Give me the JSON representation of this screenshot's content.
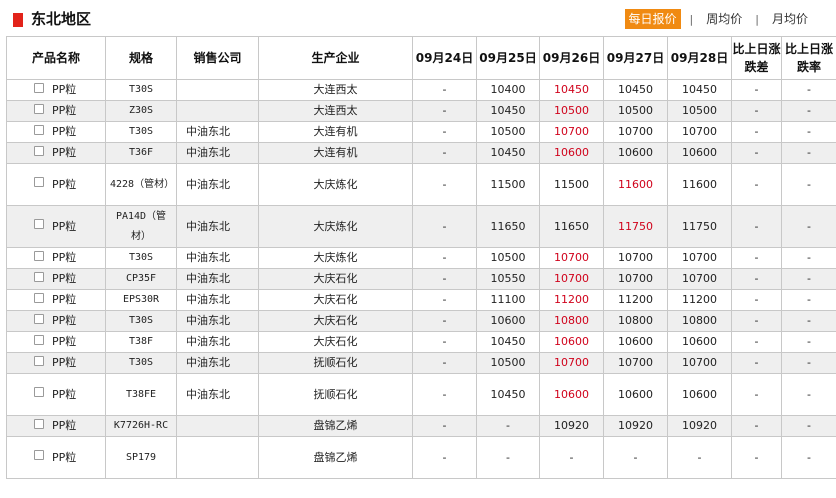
{
  "header": {
    "title": "东北地区",
    "tabs": [
      {
        "label": "每日报价",
        "active": true
      },
      {
        "label": "周均价",
        "active": false
      },
      {
        "label": "月均价",
        "active": false
      }
    ],
    "separator": "|"
  },
  "table": {
    "columns": [
      "产品名称",
      "规格",
      "销售公司",
      "生产企业",
      "09月24日",
      "09月25日",
      "09月26日",
      "09月27日",
      "09月28日",
      "比上日涨跌差",
      "比上日涨跌率"
    ],
    "rows": [
      {
        "product": "PP粒",
        "spec": "T30S",
        "company": "",
        "producer": "大连西太",
        "d24": "-",
        "d25": "10400",
        "d26": "10450",
        "d27": "10450",
        "d28": "10450",
        "diff": "-",
        "rate": "-",
        "red": "d26",
        "alt": false,
        "tall": false
      },
      {
        "product": "PP粒",
        "spec": "Z30S",
        "company": "",
        "producer": "大连西太",
        "d24": "-",
        "d25": "10450",
        "d26": "10500",
        "d27": "10500",
        "d28": "10500",
        "diff": "-",
        "rate": "-",
        "red": "d26",
        "alt": true,
        "tall": false
      },
      {
        "product": "PP粒",
        "spec": "T30S",
        "company": "中油东北",
        "producer": "大连有机",
        "d24": "-",
        "d25": "10500",
        "d26": "10700",
        "d27": "10700",
        "d28": "10700",
        "diff": "-",
        "rate": "-",
        "red": "d26",
        "alt": false,
        "tall": false
      },
      {
        "product": "PP粒",
        "spec": "T36F",
        "company": "中油东北",
        "producer": "大连有机",
        "d24": "-",
        "d25": "10450",
        "d26": "10600",
        "d27": "10600",
        "d28": "10600",
        "diff": "-",
        "rate": "-",
        "red": "d26",
        "alt": true,
        "tall": false
      },
      {
        "product": "PP粒",
        "spec": "4228（管材）",
        "company": "中油东北",
        "producer": "大庆炼化",
        "d24": "-",
        "d25": "11500",
        "d26": "11500",
        "d27": "11600",
        "d28": "11600",
        "diff": "-",
        "rate": "-",
        "red": "d27",
        "alt": false,
        "tall": true
      },
      {
        "product": "PP粒",
        "spec": "PA14D（管材）",
        "company": "中油东北",
        "producer": "大庆炼化",
        "d24": "-",
        "d25": "11650",
        "d26": "11650",
        "d27": "11750",
        "d28": "11750",
        "diff": "-",
        "rate": "-",
        "red": "d27",
        "alt": true,
        "tall": true
      },
      {
        "product": "PP粒",
        "spec": "T30S",
        "company": "中油东北",
        "producer": "大庆炼化",
        "d24": "-",
        "d25": "10500",
        "d26": "10700",
        "d27": "10700",
        "d28": "10700",
        "diff": "-",
        "rate": "-",
        "red": "d26",
        "alt": false,
        "tall": false
      },
      {
        "product": "PP粒",
        "spec": "CP35F",
        "company": "中油东北",
        "producer": "大庆石化",
        "d24": "-",
        "d25": "10550",
        "d26": "10700",
        "d27": "10700",
        "d28": "10700",
        "diff": "-",
        "rate": "-",
        "red": "d26",
        "alt": true,
        "tall": false
      },
      {
        "product": "PP粒",
        "spec": "EPS30R",
        "company": "中油东北",
        "producer": "大庆石化",
        "d24": "-",
        "d25": "11100",
        "d26": "11200",
        "d27": "11200",
        "d28": "11200",
        "diff": "-",
        "rate": "-",
        "red": "d26",
        "alt": false,
        "tall": false
      },
      {
        "product": "PP粒",
        "spec": "T30S",
        "company": "中油东北",
        "producer": "大庆石化",
        "d24": "-",
        "d25": "10600",
        "d26": "10800",
        "d27": "10800",
        "d28": "10800",
        "diff": "-",
        "rate": "-",
        "red": "d26",
        "alt": true,
        "tall": false
      },
      {
        "product": "PP粒",
        "spec": "T38F",
        "company": "中油东北",
        "producer": "大庆石化",
        "d24": "-",
        "d25": "10450",
        "d26": "10600",
        "d27": "10600",
        "d28": "10600",
        "diff": "-",
        "rate": "-",
        "red": "d26",
        "alt": false,
        "tall": false
      },
      {
        "product": "PP粒",
        "spec": "T30S",
        "company": "中油东北",
        "producer": "抚顺石化",
        "d24": "-",
        "d25": "10500",
        "d26": "10700",
        "d27": "10700",
        "d28": "10700",
        "diff": "-",
        "rate": "-",
        "red": "d26",
        "alt": true,
        "tall": false
      },
      {
        "product": "PP粒",
        "spec": "T38FE",
        "company": "中油东北",
        "producer": "抚顺石化",
        "d24": "-",
        "d25": "10450",
        "d26": "10600",
        "d27": "10600",
        "d28": "10600",
        "diff": "-",
        "rate": "-",
        "red": "d26",
        "alt": false,
        "tall": true
      },
      {
        "product": "PP粒",
        "spec": "K7726H-RC",
        "company": "",
        "producer": "盘锦乙烯",
        "d24": "-",
        "d25": "-",
        "d26": "10920",
        "d27": "10920",
        "d28": "10920",
        "diff": "-",
        "rate": "-",
        "red": "",
        "alt": true,
        "tall": false
      },
      {
        "product": "PP粒",
        "spec": "SP179",
        "company": "",
        "producer": "盘锦乙烯",
        "d24": "-",
        "d25": "-",
        "d26": "-",
        "d27": "-",
        "d28": "-",
        "diff": "-",
        "rate": "-",
        "red": "",
        "alt": false,
        "tall": true
      }
    ]
  },
  "colors": {
    "accent": "#f08a12",
    "brand_mark": "#e2231a",
    "highlight_price": "#d0021b",
    "alt_row": "#efefef"
  }
}
